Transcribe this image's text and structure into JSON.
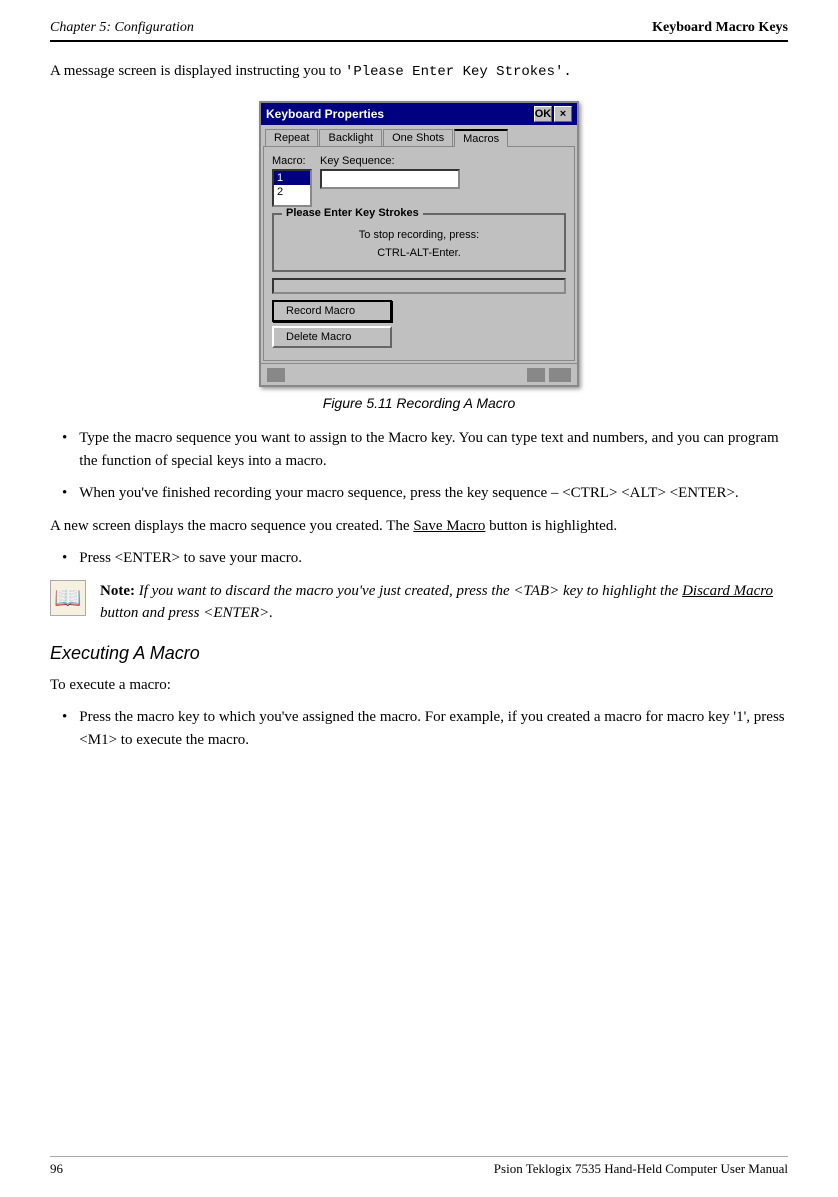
{
  "header": {
    "chapter": "Chapter  5:  Configuration",
    "section": "Keyboard Macro Keys"
  },
  "intro_text": "A message screen is displayed instructing you to ",
  "intro_code": "'Please Enter Key Strokes'.",
  "dialog": {
    "title": "Keyboard Properties",
    "ok_label": "OK",
    "close_label": "×",
    "tabs": [
      {
        "label": "Repeat",
        "active": false
      },
      {
        "label": "Backlight",
        "active": false
      },
      {
        "label": "One Shots",
        "active": false
      },
      {
        "label": "Macros",
        "active": true
      }
    ],
    "macro_label": "Macro:",
    "key_sequence_label": "Key Sequence:",
    "listbox_items": [
      "1",
      "2"
    ],
    "please_enter_title": "Please Enter Key Strokes",
    "please_enter_line1": "To stop recording, press:",
    "please_enter_line2": "CTRL-ALT-Enter.",
    "record_button": "Record Macro",
    "delete_button": "Delete Macro"
  },
  "figure_caption": "Figure 5.11  Recording A Macro",
  "bullets": [
    {
      "text": "Type the macro sequence you want to assign to the Macro key. You can type text and numbers, and you can program the function of special keys into a macro."
    },
    {
      "text": "When you've finished recording your macro sequence, press the key sequence – <CTRL> <ALT> <ENTER>."
    }
  ],
  "paragraph1": "A new screen displays the macro sequence you created. The ",
  "paragraph1_code": "Save Macro",
  "paragraph1_end": " button is highlighted.",
  "bullets2": [
    {
      "text": "Press <ENTER> to save your macro."
    }
  ],
  "note_label": "Note:",
  "note_text": "If you want to discard the macro you've just created, press the <TAB> key to highlight the ",
  "note_code": "Discard Macro",
  "note_text2": " button and press <ENTER>.",
  "section_heading": "Executing A Macro",
  "executing_intro": "To execute a macro:",
  "bullets3": [
    {
      "text": "Press the macro key to which you've assigned the macro. For example, if you created a macro for macro key '1', press <M1> to execute the macro."
    }
  ],
  "footer": {
    "page_number": "96",
    "footer_text": "Psion Teklogix 7535 Hand-Held Computer User Manual"
  }
}
